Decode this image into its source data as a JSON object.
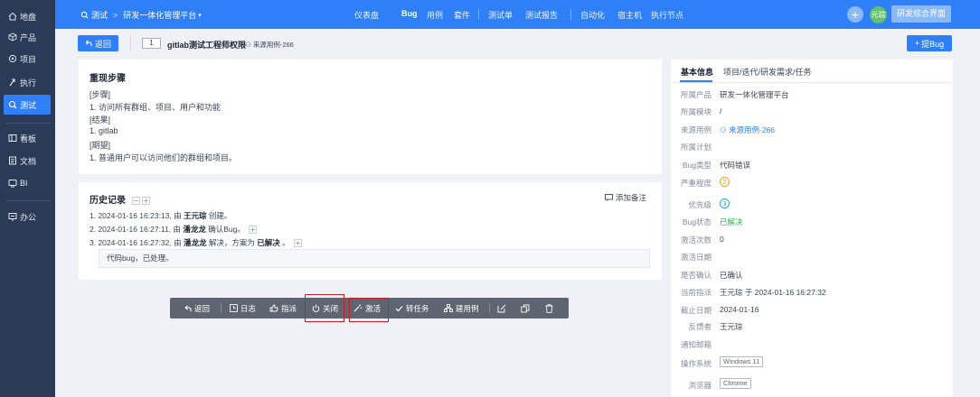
{
  "sidebar": {
    "items": [
      {
        "label": "地盘",
        "icon": "home-icon"
      },
      {
        "label": "产品",
        "icon": "cube-icon"
      },
      {
        "label": "项目",
        "icon": "project-icon"
      },
      {
        "label": "执行",
        "icon": "run-icon"
      },
      {
        "label": "测试",
        "icon": "search-icon"
      },
      {
        "label": "看板",
        "icon": "kanban-icon"
      },
      {
        "label": "文档",
        "icon": "doc-icon"
      },
      {
        "label": "BI",
        "icon": "bi-icon"
      },
      {
        "label": "办公",
        "icon": "office-icon"
      }
    ]
  },
  "topbar": {
    "crumb_module": "测试",
    "crumb_product": "研发一体化管理平台",
    "nav": [
      "仪表盘",
      "Bug",
      "用例",
      "套件",
      "测试单",
      "测试报告",
      "自动化",
      "宿主机",
      "执行节点"
    ],
    "avatar_text": "元琮",
    "portal_label": "研发综合界面"
  },
  "header": {
    "back_label": "返回",
    "bug_id": "1",
    "bug_title": "gitlab测试工程师权限",
    "source_case": "来源用例-266",
    "report_bug_label": "提Bug"
  },
  "steps": {
    "title": "重现步骤",
    "lines": [
      "[步骤]",
      "1. 访问所有群组、项目、用户和功能",
      "[结果]",
      "1. gitlab",
      "[期望]",
      "1. 普通用户可以访问他们的群组和项目。"
    ]
  },
  "history": {
    "title": "历史记录",
    "add_note_label": "添加备注",
    "entries": [
      {
        "prefix": "1. 2024-01-16 16:23:13, 由 ",
        "user": "王元琮",
        "suffix": " 创建。"
      },
      {
        "prefix": "2. 2024-01-16 16:27:11, 由 ",
        "user": "潘龙龙",
        "suffix": " 确认Bug。"
      },
      {
        "prefix": "3. 2024-01-16 16:27:32, 由 ",
        "user": "潘龙龙",
        "suffix": " 解决，方案为 ",
        "resolution": "已解决",
        "tail": " 。"
      }
    ],
    "comment": "代码bug，已处理。"
  },
  "toolbar": {
    "back": "返回",
    "log": "日志",
    "assign": "指派",
    "close": "关闭",
    "activate": "激活",
    "to_task": "转任务",
    "create_case": "建用例"
  },
  "right_panel": {
    "tabs": [
      "基本信息",
      "项目/迭代/研发需求/任务"
    ],
    "fields": [
      {
        "label": "所属产品",
        "value": "研发一体化管理平台"
      },
      {
        "label": "所属模块",
        "value": "/"
      },
      {
        "label": "来源用例",
        "value": "来源用例-266"
      },
      {
        "label": "所属计划",
        "value": ""
      },
      {
        "label": "Bug类型",
        "value": "代码错误"
      },
      {
        "label": "严重程度",
        "value": "2"
      },
      {
        "label": "优先级",
        "value": "3"
      },
      {
        "label": "Bug状态",
        "value": "已解决"
      },
      {
        "label": "激活次数",
        "value": "0"
      },
      {
        "label": "激活日期",
        "value": ""
      },
      {
        "label": "是否确认",
        "value": "已确认"
      },
      {
        "label": "当前指派",
        "value": "王元琮 于 2024-01-16 16:27:32"
      },
      {
        "label": "截止日期",
        "value": "2024-01-16"
      },
      {
        "label": "反馈者",
        "value": "王元琮"
      },
      {
        "label": "通知邮箱",
        "value": ""
      },
      {
        "label": "操作系统",
        "value": "Windows 11"
      },
      {
        "label": "浏览器",
        "value": "Chrome"
      }
    ]
  },
  "colors": {
    "brand": "#2e7ff8",
    "sidebar": "#2a3a57",
    "resolved": "#2eb34b",
    "highlight": "#c8202a"
  }
}
